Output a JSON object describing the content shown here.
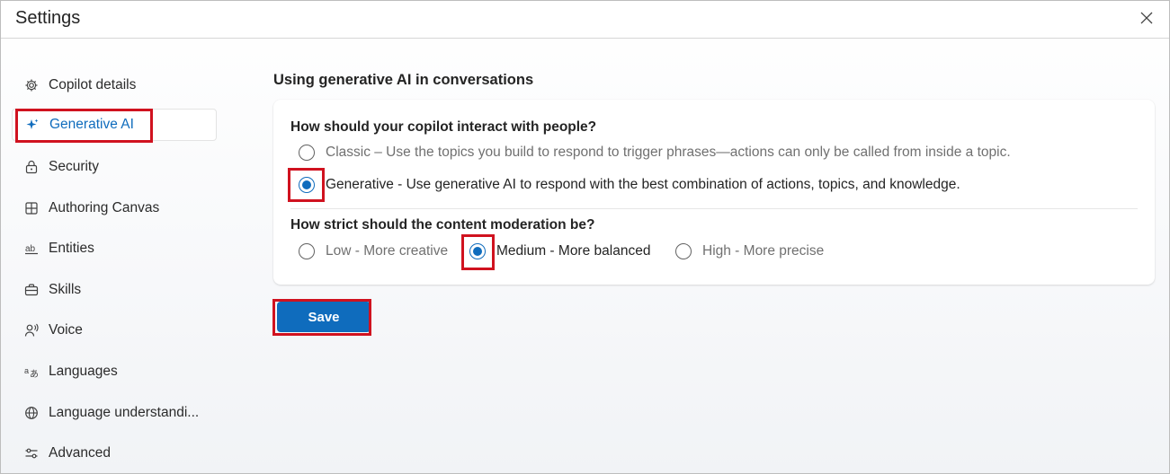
{
  "window": {
    "title": "Settings",
    "close_icon": "close-icon"
  },
  "sidebar": {
    "items": [
      {
        "label": "Copilot details",
        "icon": "gear-icon",
        "selected": false
      },
      {
        "label": "Generative AI",
        "icon": "sparkle-icon",
        "selected": true
      },
      {
        "label": "Security",
        "icon": "lock-icon",
        "selected": false
      },
      {
        "label": "Authoring Canvas",
        "icon": "grid-icon",
        "selected": false
      },
      {
        "label": "Entities",
        "icon": "text-ab-icon",
        "selected": false
      },
      {
        "label": "Skills",
        "icon": "briefcase-icon",
        "selected": false
      },
      {
        "label": "Voice",
        "icon": "person-voice-icon",
        "selected": false
      },
      {
        "label": "Languages",
        "icon": "translate-icon",
        "selected": false
      },
      {
        "label": "Language understandi...",
        "icon": "globe-icon",
        "selected": false
      },
      {
        "label": "Advanced",
        "icon": "sliders-icon",
        "selected": false
      }
    ]
  },
  "main": {
    "section_title": "Using generative AI in conversations",
    "q1": {
      "label": "How should your copilot interact with people?",
      "options": [
        {
          "label": "Classic – Use the topics you build to respond to trigger phrases—actions can only be called from inside a topic.",
          "checked": false
        },
        {
          "label": "Generative - Use generative AI to respond with the best combination of actions, topics, and knowledge.",
          "checked": true
        }
      ]
    },
    "q2": {
      "label": "How strict should the content moderation be?",
      "options": [
        {
          "label": "Low - More creative",
          "checked": false
        },
        {
          "label": "Medium - More balanced",
          "checked": true
        },
        {
          "label": "High - More precise",
          "checked": false
        }
      ]
    },
    "save_label": "Save"
  },
  "colors": {
    "accent": "#0f6cbd",
    "highlight": "#d0121f"
  }
}
